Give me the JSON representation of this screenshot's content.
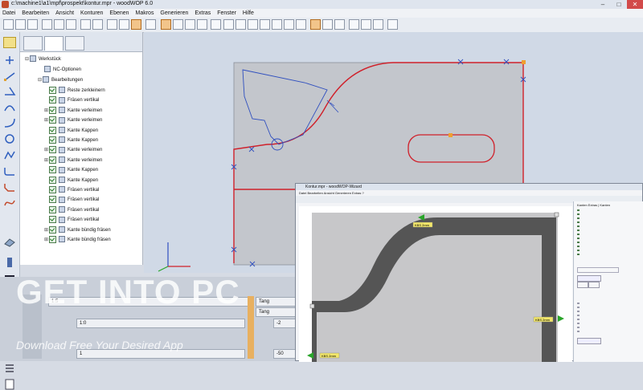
{
  "window": {
    "title": "c:\\machine1\\a1\\mpf\\prospekt\\kontur.mpr - woodWOP 6.0",
    "min": "–",
    "max": "□",
    "close": "✕"
  },
  "menu": [
    "Datei",
    "Bearbeiten",
    "Ansicht",
    "Konturen",
    "Ebenen",
    "Makros",
    "Generieren",
    "Extras",
    "Fenster",
    "Hilfe"
  ],
  "tree": {
    "root": "Werkstück",
    "nc": "NC-Optionen",
    "group": "Bearbeitungen",
    "items": [
      "Reste zerkleinern",
      "Fräsen vertikal",
      "Kante verleimen",
      "Kante verleimen",
      "Kante Kappen",
      "Kante Kappen",
      "Kante verleimen",
      "Kante verleimen",
      "Kante Kappen",
      "Kante Kappen",
      "Fräsen vertikal",
      "Fräsen vertikal",
      "Fräsen vertikal",
      "Fräsen vertikal",
      "Kante bündig fräsen",
      "Kante bündig fräsen"
    ]
  },
  "params": {
    "row1": "1:5",
    "row2": "1:0",
    "row3": "1",
    "tang1": "Tang",
    "tang2": "Tang",
    "v2": "-2",
    "v50": "-50"
  },
  "sub": {
    "title": "Kontur.mpr - woodWOP-Wizard",
    "menu": "Datei  Bearbeiten  Ansicht  Generieren  Extras  ?",
    "tabs": "Kanten  Extras | Kanten",
    "labels": [
      "KBS 2mm",
      "KBS 2mm",
      "KBS 2mm"
    ]
  },
  "watermark": {
    "main_a": "GET ",
    "main_b": "INTO",
    "main_c": " PC",
    "sub": "Download Free Your Desired App"
  },
  "colors": {
    "contour": "#d0202a",
    "tool": "#2f4fbf",
    "edge": "#555555"
  }
}
